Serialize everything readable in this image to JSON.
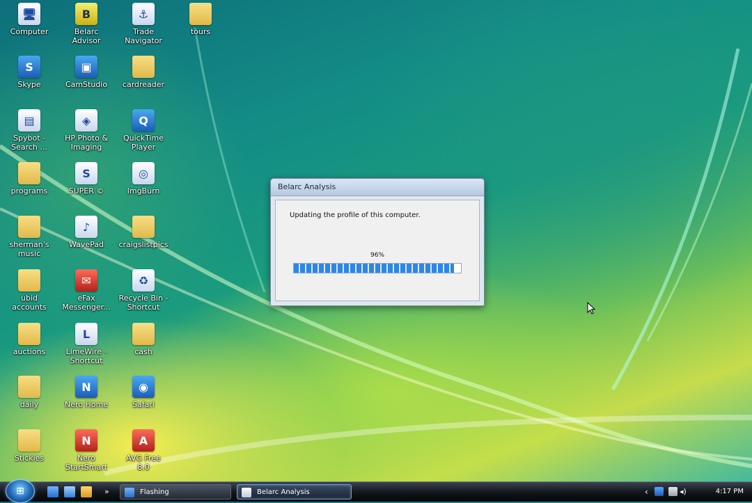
{
  "desktop_icons": [
    {
      "label": "Computer",
      "kind": "app",
      "glyph": "🖥"
    },
    {
      "label": "Belarc\nAdvisor",
      "kind": "yellow",
      "glyph": "B"
    },
    {
      "label": "Trade\nNavigator",
      "kind": "app",
      "glyph": "⚓"
    },
    {
      "label": "tours",
      "kind": "folder",
      "glyph": ""
    },
    {
      "label": "Skype",
      "kind": "blue",
      "glyph": "S"
    },
    {
      "label": "CamStudio",
      "kind": "blue",
      "glyph": "▣"
    },
    {
      "label": "cardreader",
      "kind": "folder",
      "glyph": ""
    },
    {
      "label": "Spybot -\nSearch ...",
      "kind": "app",
      "glyph": "▤"
    },
    {
      "label": "HP Photo &\nImaging",
      "kind": "app",
      "glyph": "◈"
    },
    {
      "label": "QuickTime\nPlayer",
      "kind": "blue",
      "glyph": "Q"
    },
    {
      "label": "programs",
      "kind": "folder",
      "glyph": ""
    },
    {
      "label": "SUPER ©",
      "kind": "app",
      "glyph": "S"
    },
    {
      "label": "ImgBurn",
      "kind": "app",
      "glyph": "◎"
    },
    {
      "label": "sherman's\nmusic",
      "kind": "folder",
      "glyph": ""
    },
    {
      "label": "WavePad",
      "kind": "app",
      "glyph": "♪"
    },
    {
      "label": "craigslistpics",
      "kind": "folder",
      "glyph": ""
    },
    {
      "label": "ubid\naccounts",
      "kind": "folder",
      "glyph": ""
    },
    {
      "label": "eFax\nMessenger...",
      "kind": "red",
      "glyph": "✉"
    },
    {
      "label": "Recycle Bin -\nShortcut",
      "kind": "app",
      "glyph": "♻"
    },
    {
      "label": "auctions",
      "kind": "folder",
      "glyph": ""
    },
    {
      "label": "LimeWire -\nShortcut",
      "kind": "app",
      "glyph": "L"
    },
    {
      "label": "cash",
      "kind": "folder",
      "glyph": ""
    },
    {
      "label": "daily",
      "kind": "folder",
      "glyph": ""
    },
    {
      "label": "Nero Home",
      "kind": "blue",
      "glyph": "N"
    },
    {
      "label": "Safari",
      "kind": "blue",
      "glyph": "◉"
    },
    {
      "label": "Stickies",
      "kind": "folder",
      "glyph": ""
    },
    {
      "label": "Nero\nStartSmart",
      "kind": "red",
      "glyph": "N"
    },
    {
      "label": "AVG Free\n8.0",
      "kind": "red",
      "glyph": "A"
    }
  ],
  "dialog": {
    "title": "Belarc Analysis",
    "message": "Updating the profile of this computer.",
    "percent_label": "96%",
    "progress": 0.96
  },
  "taskbar": {
    "start_glyph": "⊞",
    "quick_launch_arrow": "»",
    "tasks": [
      {
        "label": "Flashing",
        "active": false
      },
      {
        "label": "Belarc Analysis",
        "active": true
      }
    ],
    "clock": "4:17 PM",
    "tray_arrow": "‹"
  },
  "colors": {
    "progress_fill": "#2e86e6",
    "taskbar_active": "#2b3a4d"
  }
}
